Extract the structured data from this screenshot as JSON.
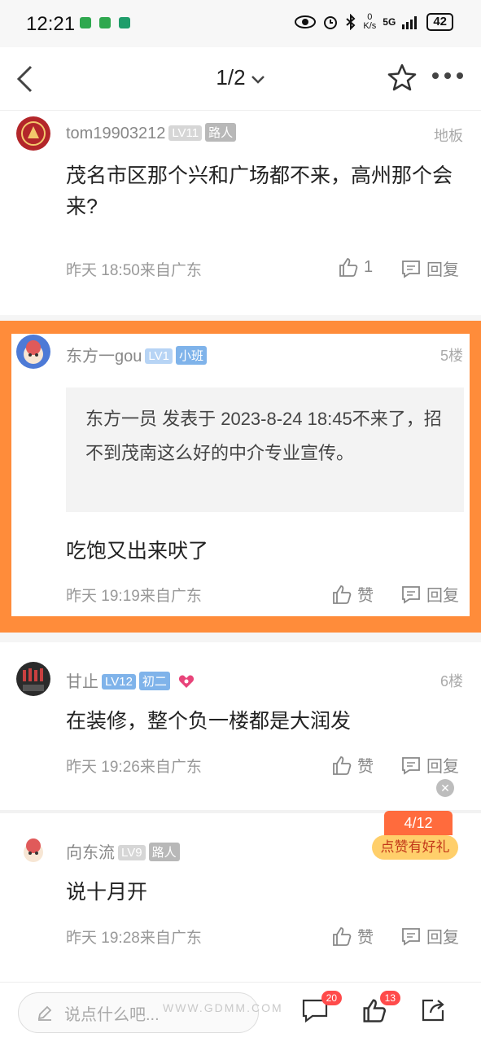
{
  "status_bar": {
    "time": "12:21",
    "net_speed_top": "0",
    "net_speed_unit": "K/s",
    "signal": "5G",
    "battery": "42"
  },
  "nav": {
    "page": "1/2"
  },
  "posts": [
    {
      "username": "tom19903212",
      "level": "LV11",
      "rank": "路人",
      "floor": "地板",
      "content": "茂名市区那个兴和广场都不来，高州那个会来?",
      "meta": "昨天 18:50来自广东",
      "likes": "1",
      "reply_label": "回复"
    },
    {
      "username": "东方一gou",
      "level": "LV1",
      "rank": "小班",
      "floor": "5楼",
      "quote": "东方一员 发表于 2023-8-24 18:45不来了，招不到茂南这么好的中介专业宣传。",
      "content": "吃饱又出来吠了",
      "meta": "昨天 19:19来自广东",
      "like_label": "赞",
      "reply_label": "回复"
    },
    {
      "username": "甘止",
      "level": "LV12",
      "rank": "初二",
      "floor": "6楼",
      "content": "在装修，整个负一楼都是大润发",
      "meta": "昨天 19:26来自广东",
      "like_label": "赞",
      "reply_label": "回复"
    },
    {
      "username": "向东流",
      "level": "LV9",
      "rank": "路人",
      "content": "说十月开",
      "meta": "昨天 19:28来自广东",
      "like_label": "赞",
      "reply_label": "回复"
    }
  ],
  "promo": {
    "count": "4/12",
    "label": "点赞有好礼"
  },
  "bottom_bar": {
    "placeholder": "说点什么吧...",
    "comment_count": "20",
    "like_count": "13"
  },
  "watermark": "WWW.GDMM.COM",
  "colors": {
    "highlight": "#ff8c3a",
    "badge_red": "#ff4b4b"
  }
}
